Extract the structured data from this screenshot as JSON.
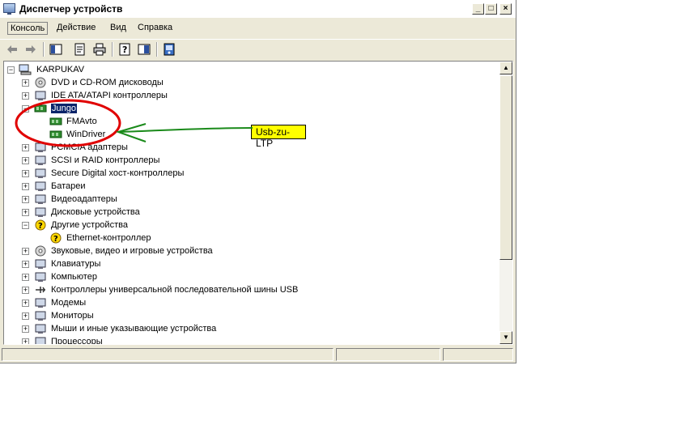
{
  "window": {
    "title": "Диспетчер устройств",
    "title_icon": "device-manager-icon",
    "controls": [
      "_",
      "□",
      "×"
    ]
  },
  "menu": {
    "items": [
      "Консоль",
      "Действие",
      "Вид",
      "Справка"
    ],
    "active": "Консоль"
  },
  "toolbar": {
    "icons": [
      "back-arrow-icon",
      "forward-arrow-icon",
      "show-hide-tree-icon",
      "properties-icon",
      "print-icon",
      "help-icon",
      "console-tree-icon",
      "scan-hardware-icon"
    ]
  },
  "tree": {
    "root": "KARPUKAV",
    "items": [
      {
        "label": "DVD и CD-ROM дисководы",
        "expander": "+",
        "icon": "cdrom-icon"
      },
      {
        "label": "IDE ATA/ATAPI контроллеры",
        "expander": "+",
        "icon": "ide-controller-icon"
      },
      {
        "label": "Jungo",
        "expander": "−",
        "icon": "board-icon",
        "selected": true
      },
      {
        "label": "FMAvto",
        "expander": "",
        "icon": "board-icon"
      },
      {
        "label": "WinDriver",
        "expander": "",
        "icon": "board-icon"
      },
      {
        "label": "PCMCIA адаптеры",
        "expander": "+",
        "icon": "pcmcia-icon"
      },
      {
        "label": "SCSI и RAID контроллеры",
        "expander": "+",
        "icon": "scsi-icon"
      },
      {
        "label": "Secure Digital хост-контроллеры",
        "expander": "+",
        "icon": "sd-host-icon"
      },
      {
        "label": "Батареи",
        "expander": "+",
        "icon": "battery-icon"
      },
      {
        "label": "Видеоадаптеры",
        "expander": "+",
        "icon": "display-adapter-icon"
      },
      {
        "label": "Дисковые устройства",
        "expander": "+",
        "icon": "disk-drive-icon"
      },
      {
        "label": "Другие устройства",
        "expander": "−",
        "icon": "unknown-device-icon"
      },
      {
        "label": "Ethernet-контроллер",
        "expander": "",
        "icon": "warning-device-icon"
      },
      {
        "label": "Звуковые, видео и игровые устройства",
        "expander": "+",
        "icon": "speaker-icon"
      },
      {
        "label": "Клавиатуры",
        "expander": "+",
        "icon": "keyboard-icon"
      },
      {
        "label": "Компьютер",
        "expander": "+",
        "icon": "computer-icon"
      },
      {
        "label": "Контроллеры универсальной последовательной шины USB",
        "expander": "+",
        "icon": "usb-icon"
      },
      {
        "label": "Модемы",
        "expander": "+",
        "icon": "modem-icon"
      },
      {
        "label": "Мониторы",
        "expander": "+",
        "icon": "monitor-icon"
      },
      {
        "label": "Мыши и иные указывающие устройства",
        "expander": "+",
        "icon": "mouse-icon"
      },
      {
        "label": "Процессоры",
        "expander": "+",
        "icon": "processor-icon"
      }
    ]
  },
  "annotation": {
    "callout_text": "Usb-zu-LTP",
    "ellipse_color": "#e00000",
    "arrow_color": "#1a8a1a",
    "callout_bg": "#ffff00"
  },
  "colors": {
    "selection": "#0a246a",
    "chrome": "#ece9d8"
  }
}
